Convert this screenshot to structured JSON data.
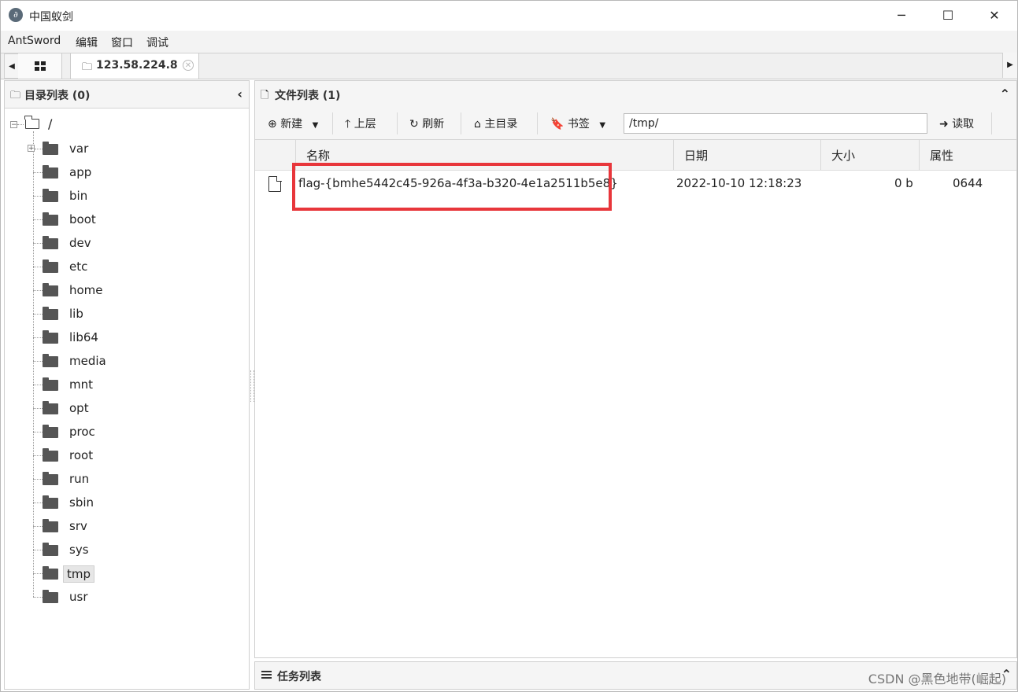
{
  "window": {
    "title": "中国蚁剑",
    "minimize": "─",
    "maximize": "☐",
    "close": "✕"
  },
  "menu": [
    "AntSword",
    "编辑",
    "窗口",
    "调试"
  ],
  "tabs": {
    "host": "123.58.224.8",
    "close": "✕"
  },
  "left_panel": {
    "title": "目录列表 (0)",
    "collapse": "‹",
    "root": "/",
    "items": [
      "var",
      "app",
      "bin",
      "boot",
      "dev",
      "etc",
      "home",
      "lib",
      "lib64",
      "media",
      "mnt",
      "opt",
      "proc",
      "root",
      "run",
      "sbin",
      "srv",
      "sys",
      "tmp",
      "usr"
    ],
    "selected": "tmp"
  },
  "right_panel": {
    "title": "文件列表 (1)",
    "collapse": "⌃",
    "toolbar": {
      "new": "新建",
      "up": "上层",
      "refresh": "刷新",
      "home": "主目录",
      "bookmark": "书签",
      "path": "/tmp/",
      "read": "读取"
    },
    "columns": {
      "name": "名称",
      "date": "日期",
      "size": "大小",
      "attr": "属性"
    },
    "files": [
      {
        "name": "flag-{bmhe5442c45-926a-4f3a-b320-4e1a2511b5e8}",
        "date": "2022-10-10 12:18:23",
        "size": "0 b",
        "attr": "0644"
      }
    ]
  },
  "task_panel": {
    "title": "任务列表",
    "collapse": "⌃"
  },
  "watermark": "CSDN @黑色地带(崛起)",
  "colors": {
    "highlight": "#e8363b"
  }
}
